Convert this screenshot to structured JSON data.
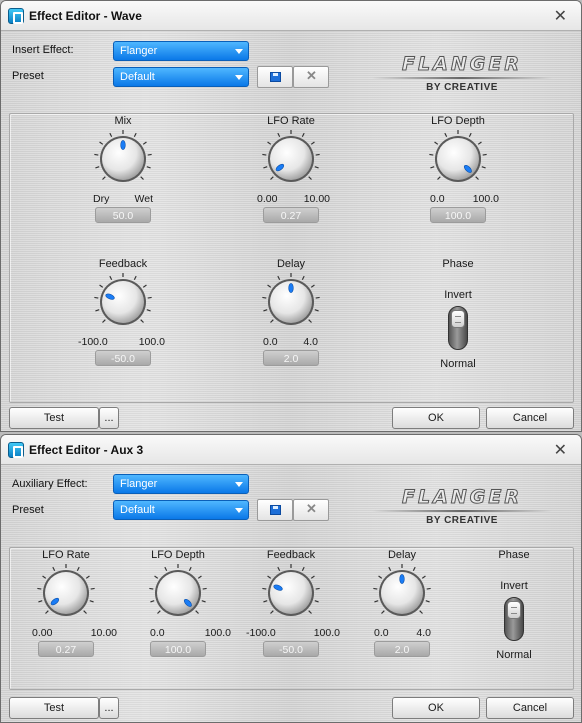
{
  "window1": {
    "title": "Effect Editor - Wave",
    "effect_label": "Insert Effect:",
    "effect_value": "Flanger",
    "preset_label": "Preset",
    "preset_value": "Default",
    "logo": {
      "name": "FLANGER",
      "by": "BY CREATIVE"
    },
    "knobs": [
      {
        "label": "Mix",
        "min": "Dry",
        "max": "Wet",
        "value": "50.0",
        "level": 0.5
      },
      {
        "label": "LFO Rate",
        "min": "0.00",
        "max": "10.00",
        "value": "0.27",
        "level": 0.027
      },
      {
        "label": "LFO Depth",
        "min": "0.0",
        "max": "100.0",
        "value": "100.0",
        "level": 1.0
      },
      {
        "label": "Feedback",
        "min": "-100.0",
        "max": "100.0",
        "value": "-50.0",
        "level": 0.25
      },
      {
        "label": "Delay",
        "min": "0.0",
        "max": "4.0",
        "value": "2.0",
        "level": 0.5
      }
    ],
    "phase": {
      "label": "Phase",
      "top": "Invert",
      "bottom": "Normal"
    },
    "buttons": {
      "test": "Test",
      "more": "...",
      "ok": "OK",
      "cancel": "Cancel"
    }
  },
  "window2": {
    "title": "Effect Editor - Aux 3",
    "effect_label": "Auxiliary Effect:",
    "effect_value": "Flanger",
    "preset_label": "Preset",
    "preset_value": "Default",
    "logo": {
      "name": "FLANGER",
      "by": "BY CREATIVE"
    },
    "knobs": [
      {
        "label": "LFO Rate",
        "min": "0.00",
        "max": "10.00",
        "value": "0.27",
        "level": 0.027
      },
      {
        "label": "LFO Depth",
        "min": "0.0",
        "max": "100.0",
        "value": "100.0",
        "level": 1.0
      },
      {
        "label": "Feedback",
        "min": "-100.0",
        "max": "100.0",
        "value": "-50.0",
        "level": 0.25
      },
      {
        "label": "Delay",
        "min": "0.0",
        "max": "4.0",
        "value": "2.0",
        "level": 0.5
      }
    ],
    "phase": {
      "label": "Phase",
      "top": "Invert",
      "bottom": "Normal"
    },
    "buttons": {
      "test": "Test",
      "more": "...",
      "ok": "OK",
      "cancel": "Cancel"
    }
  },
  "colors": {
    "combo": "#1f8af0",
    "indicator": "#1a7cf5"
  }
}
